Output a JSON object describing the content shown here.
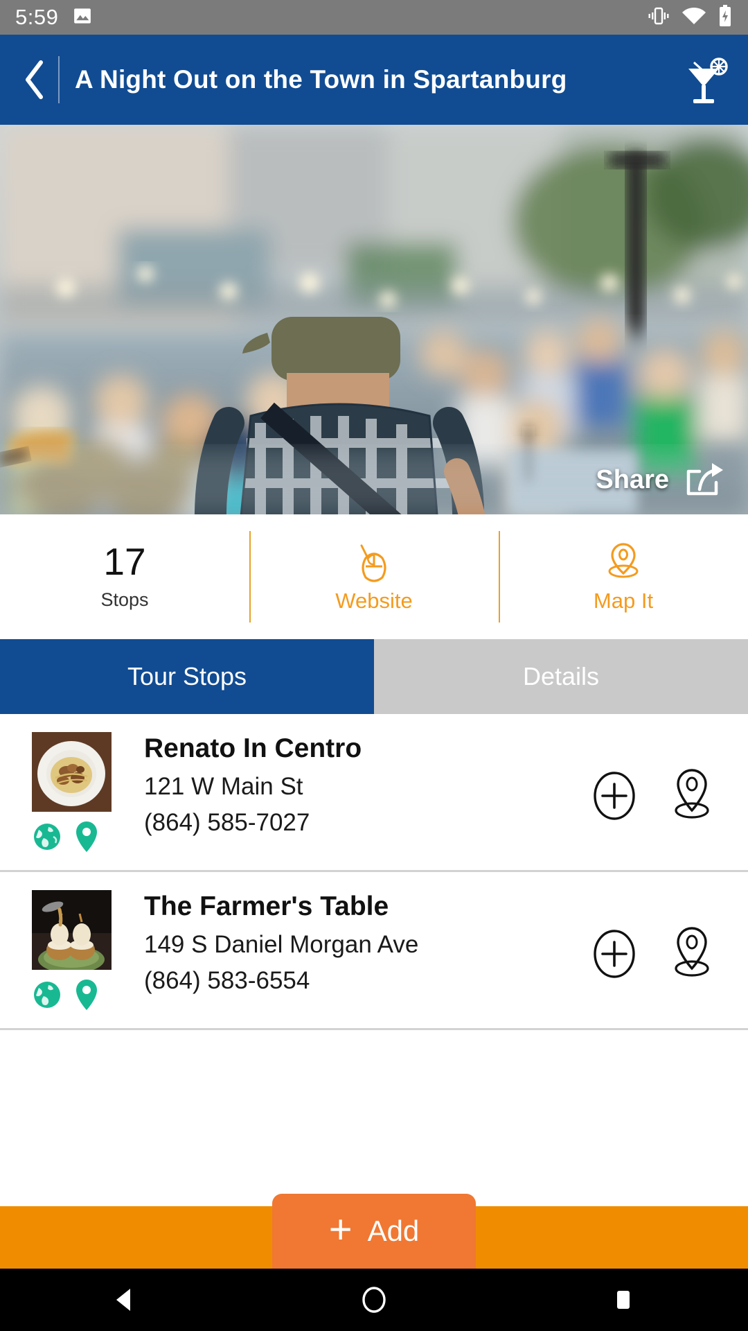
{
  "status_bar": {
    "time": "5:59",
    "icons": [
      "image-icon",
      "vibrate-icon",
      "wifi-icon",
      "battery-charging-icon"
    ]
  },
  "header": {
    "title": "A Night Out on the Town in Spartanburg",
    "back_icon": "chevron-left-icon",
    "action_icon": "cocktail-icon",
    "background_color": "#114C92"
  },
  "hero": {
    "share_label": "Share",
    "share_icon": "share-arrow-icon",
    "alt": "Musician with guitar performing outdoors in front of a seated crowd"
  },
  "stats": {
    "count": "17",
    "count_label": "Stops",
    "website_label": "Website",
    "website_icon": "mouse-icon",
    "map_label": "Map It",
    "map_icon": "map-pin-icon",
    "accent_color": "#F49B1E"
  },
  "tabs": [
    {
      "label": "Tour Stops",
      "active": true
    },
    {
      "label": "Details",
      "active": false
    }
  ],
  "stops": [
    {
      "name": "Renato In Centro",
      "address": "121 W Main St",
      "phone": "(864) 585-7027",
      "mini_icons": [
        "globe-icon",
        "map-pin-icon"
      ],
      "mini_icon_color": "#18B992",
      "actions": [
        "add-circle-icon",
        "map-pin-outline-icon"
      ],
      "thumb_alt": "Plate of pasta bolognese"
    },
    {
      "name": "The Farmer's Table",
      "address": "149 S Daniel Morgan Ave",
      "phone": "(864) 583-6554",
      "mini_icons": [
        "globe-icon",
        "map-pin-icon"
      ],
      "mini_icon_color": "#18B992",
      "actions": [
        "add-circle-icon",
        "map-pin-outline-icon"
      ],
      "thumb_alt": "Dessert dish with sauce being poured"
    }
  ],
  "bottom_bar": {
    "add_label": "Add",
    "add_plus": "+",
    "bar_color": "#F08C00",
    "button_color": "#F07832"
  },
  "nav_bar": {
    "back_icon": "triangle-back-icon",
    "home_icon": "circle-home-icon",
    "recents_icon": "square-recents-icon"
  }
}
